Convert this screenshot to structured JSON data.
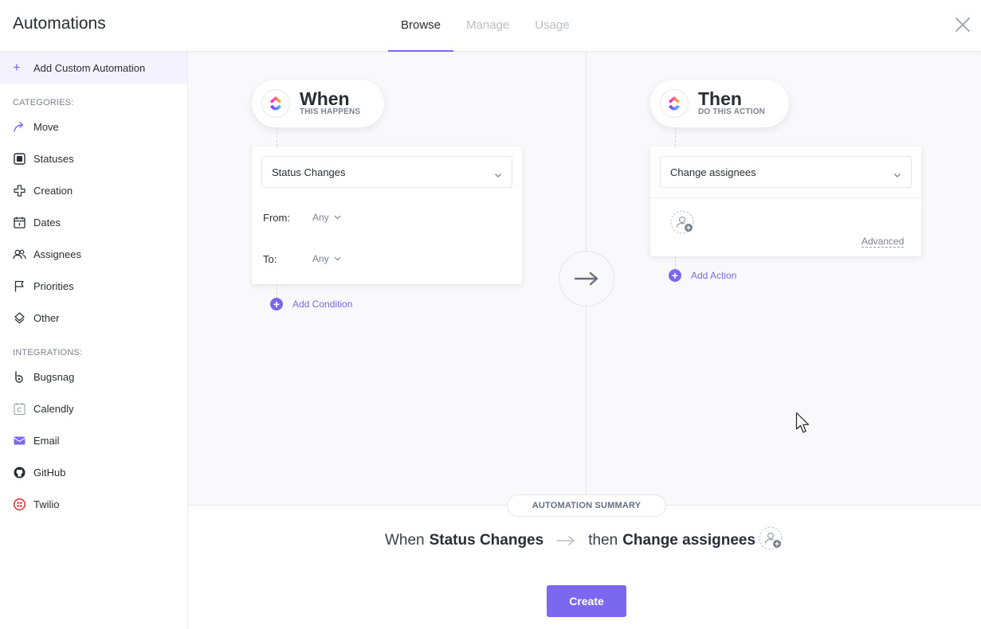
{
  "header": {
    "title": "Automations",
    "tabs": [
      {
        "label": "Browse",
        "active": true
      },
      {
        "label": "Manage",
        "active": false
      },
      {
        "label": "Usage",
        "active": false
      }
    ],
    "close_icon": "close-icon"
  },
  "sidebar": {
    "add_custom": "Add Custom Automation",
    "categories_title": "CATEGORIES:",
    "categories": [
      {
        "label": "Move",
        "icon": "move-arrow-icon"
      },
      {
        "label": "Statuses",
        "icon": "status-square-icon"
      },
      {
        "label": "Creation",
        "icon": "plus-outline-icon"
      },
      {
        "label": "Dates",
        "icon": "calendar-icon"
      },
      {
        "label": "Assignees",
        "icon": "users-icon"
      },
      {
        "label": "Priorities",
        "icon": "flag-icon"
      },
      {
        "label": "Other",
        "icon": "layers-icon"
      }
    ],
    "integrations_title": "INTEGRATIONS:",
    "integrations": [
      {
        "label": "Bugsnag",
        "icon": "bugsnag-icon"
      },
      {
        "label": "Calendly",
        "icon": "calendly-icon"
      },
      {
        "label": "Email",
        "icon": "email-icon"
      },
      {
        "label": "GitHub",
        "icon": "github-icon"
      },
      {
        "label": "Twilio",
        "icon": "twilio-icon"
      }
    ]
  },
  "trigger": {
    "title": "When",
    "subtitle": "THIS HAPPENS",
    "select_value": "Status Changes",
    "from_label": "From:",
    "from_value": "Any",
    "to_label": "To:",
    "to_value": "Any",
    "add_condition": "Add Condition"
  },
  "action": {
    "title": "Then",
    "subtitle": "DO THIS ACTION",
    "select_value": "Change assignees",
    "advanced": "Advanced",
    "add_action": "Add Action"
  },
  "summary": {
    "badge": "AUTOMATION SUMMARY",
    "when_word": "When",
    "when_value": "Status Changes",
    "then_word": "then",
    "then_value": "Change assignees"
  },
  "create_button": "Create",
  "colors": {
    "accent": "#7b68ee",
    "text": "#292d34",
    "muted": "#7c828d",
    "canvas_bg": "#f9f9fb"
  }
}
